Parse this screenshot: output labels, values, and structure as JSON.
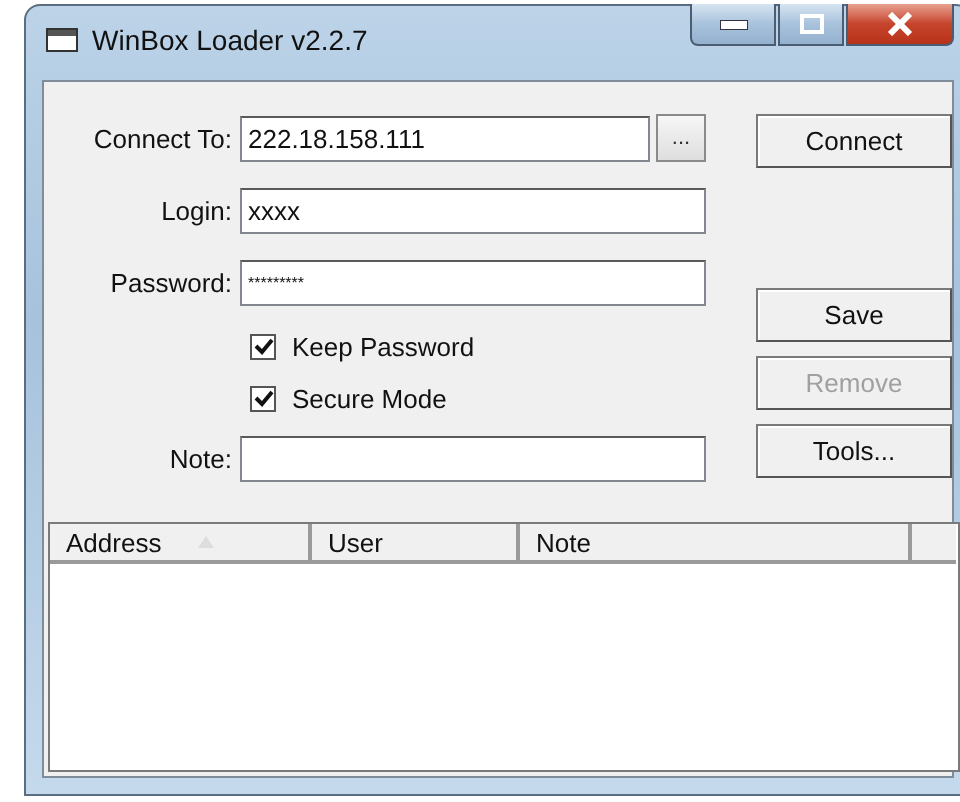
{
  "window": {
    "title": "WinBox Loader v2.2.7"
  },
  "fields": [
    {
      "label": "Connect To:",
      "value": "222.18.158.111",
      "kind": "browse",
      "browse": "..."
    },
    {
      "label": "Login:",
      "value": "xxxx",
      "kind": "text"
    },
    {
      "label": "Password:",
      "value": "*********",
      "kind": "masked"
    }
  ],
  "options": [
    {
      "label": "Keep Password",
      "checked": true
    },
    {
      "label": "Secure Mode",
      "checked": true
    }
  ],
  "note_field": {
    "label": "Note:"
  },
  "buttons": [
    {
      "label": "Connect",
      "disabled": false
    },
    {
      "label": "Save",
      "disabled": false
    },
    {
      "label": "Remove",
      "disabled": true
    },
    {
      "label": "Tools...",
      "disabled": false
    }
  ],
  "table": {
    "columns": [
      {
        "label": "Address",
        "sorted": true
      },
      {
        "label": "User",
        "sorted": false
      },
      {
        "label": "Note",
        "sorted": false
      }
    ]
  }
}
